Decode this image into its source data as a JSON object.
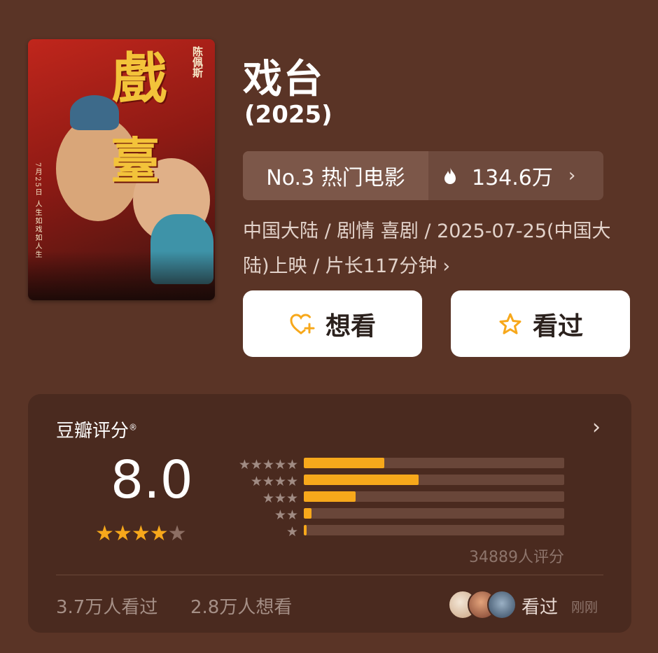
{
  "poster": {
    "big_char_1": "戲",
    "big_char_2": "臺",
    "director_text": "陈佩斯",
    "side_text": "7月25日 人生如戏如人生"
  },
  "movie": {
    "title": "戏台",
    "year": "(2025)"
  },
  "rank": {
    "label": "No.3 热门电影",
    "heat": "134.6万"
  },
  "meta": {
    "line": "中国大陆 / 剧情 喜剧 / 2025-07-25(中国大陆)上映 / 片长117分钟"
  },
  "actions": {
    "want_label": "想看",
    "seen_label": "看过"
  },
  "rating": {
    "title": "豆瓣评分",
    "trademark": "®",
    "score": "8.0",
    "stars_filled": 4,
    "stars_total": 5,
    "distribution": [
      {
        "stars": 5,
        "fraction": 0.31
      },
      {
        "stars": 4,
        "fraction": 0.44
      },
      {
        "stars": 3,
        "fraction": 0.2
      },
      {
        "stars": 2,
        "fraction": 0.03
      },
      {
        "stars": 1,
        "fraction": 0.01
      }
    ],
    "count_text": "34889人评分",
    "watched_text": "3.7万人看过",
    "wished_text": "2.8万人想看",
    "recent_label": "看过",
    "recent_time": "刚刚"
  },
  "colors": {
    "background": "#5a3426",
    "panel": "#4a2a1f",
    "accent": "#f7a81b",
    "button": "#ffffff"
  }
}
